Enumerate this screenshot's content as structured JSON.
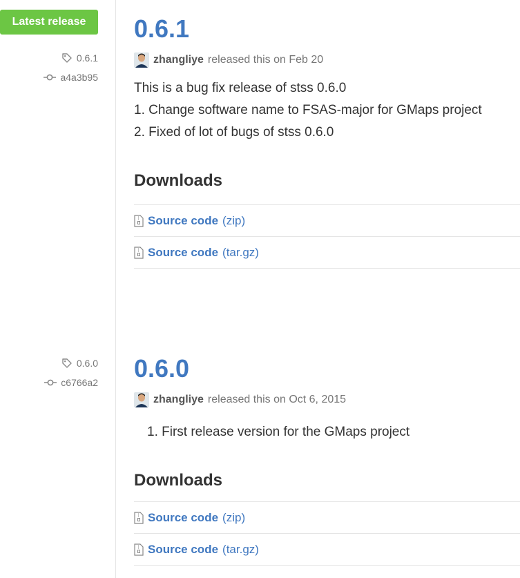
{
  "releases": [
    {
      "badge": "Latest release",
      "tag": "0.6.1",
      "commit": "a4a3b95",
      "version": "0.6.1",
      "author": "zhangliye",
      "released_text": "released this on Feb 20",
      "notes": [
        "This is a bug fix release of stss 0.6.0",
        "1. Change software name to FSAS-major for GMaps project",
        "2. Fixed of lot of bugs of stss 0.6.0"
      ],
      "downloads_title": "Downloads",
      "downloads": [
        {
          "label": "Source code",
          "ext": "(zip)"
        },
        {
          "label": "Source code",
          "ext": "(tar.gz)"
        }
      ]
    },
    {
      "tag": "0.6.0",
      "commit": "c6766a2",
      "version": "0.6.0",
      "author": "zhangliye",
      "released_text": "released this on Oct 6, 2015",
      "notes": [
        "1. First release version for the GMaps project"
      ],
      "downloads_title": "Downloads",
      "downloads": [
        {
          "label": "Source code",
          "ext": "(zip)"
        },
        {
          "label": "Source code",
          "ext": "(tar.gz)"
        }
      ]
    }
  ],
  "icons": {
    "tag": "tag-icon",
    "commit": "commit-icon",
    "file": "file-zip-icon",
    "avatar": "avatar"
  },
  "colors": {
    "accent": "#4078c0",
    "badge": "#6cc644",
    "muted": "#767676",
    "border": "#e5e5e5"
  }
}
